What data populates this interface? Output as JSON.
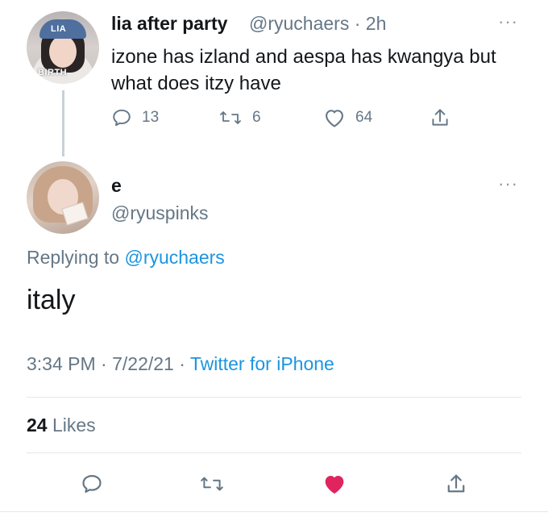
{
  "parent_tweet": {
    "avatar_tag_top": "LIA",
    "avatar_tag_bottom": "BIRTH",
    "display_name": "lia after party",
    "handle_time": "@ryuchaers · 2h",
    "more_label": "···",
    "text": "izone has izland and aespa has kwangya but what does itzy have",
    "reply_count": "13",
    "retweet_count": "6",
    "like_count": "64"
  },
  "reply_tweet": {
    "display_name": "e",
    "handle": "@ryuspinks",
    "more_label": "···",
    "replying_prefix": "Replying to",
    "replying_handle": "@ryuchaers",
    "text": "italy",
    "timestamp": "3:34 PM · 7/22/21 · ",
    "source": "Twitter for iPhone",
    "likes_count": "24",
    "likes_label": "Likes"
  },
  "colors": {
    "text": "#14171a",
    "secondary": "#657786",
    "link": "#1b95e0",
    "like_active": "#e0245e",
    "divider": "#e1e8ed"
  },
  "icons": {
    "reply": "reply-icon",
    "retweet": "retweet-icon",
    "like": "heart-icon",
    "share": "share-icon"
  }
}
